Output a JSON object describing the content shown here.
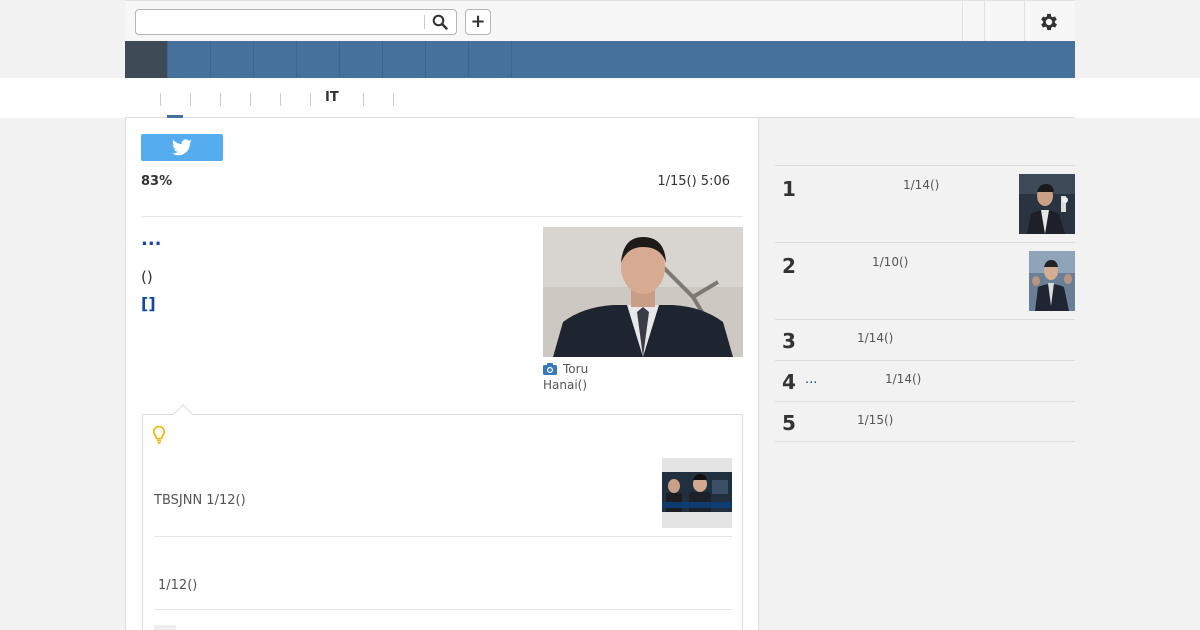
{
  "colors": {
    "nav": "#46719b",
    "nav_active": "#3f4a57",
    "twitter": "#55acee",
    "link": "#1546a0"
  },
  "topbar": {
    "search_placeholder": "",
    "search_icon": "search-icon",
    "add_label": "+",
    "settings_icon": "gear-icon"
  },
  "subnav": {
    "label": "IT"
  },
  "article": {
    "percent": "83%",
    "date": "1/15() 5:06",
    "ellipsis": "...",
    "paren": "()",
    "bracket": "[]",
    "credit": "Toru Hanai()"
  },
  "related": {
    "icon": "lightbulb-icon",
    "source": "TBSJNN 1/12()",
    "date2": "1/12()"
  },
  "ranking": [
    {
      "rank": "1",
      "date": "1/14()",
      "ellipsis": "",
      "has_thumb": true
    },
    {
      "rank": "2",
      "date": "1/10()",
      "ellipsis": "",
      "has_thumb": true
    },
    {
      "rank": "3",
      "date": "1/14()",
      "ellipsis": "",
      "has_thumb": false
    },
    {
      "rank": "4",
      "date": "1/14()",
      "ellipsis": "...",
      "has_thumb": false
    },
    {
      "rank": "5",
      "date": "1/15()",
      "ellipsis": "",
      "has_thumb": false
    }
  ]
}
